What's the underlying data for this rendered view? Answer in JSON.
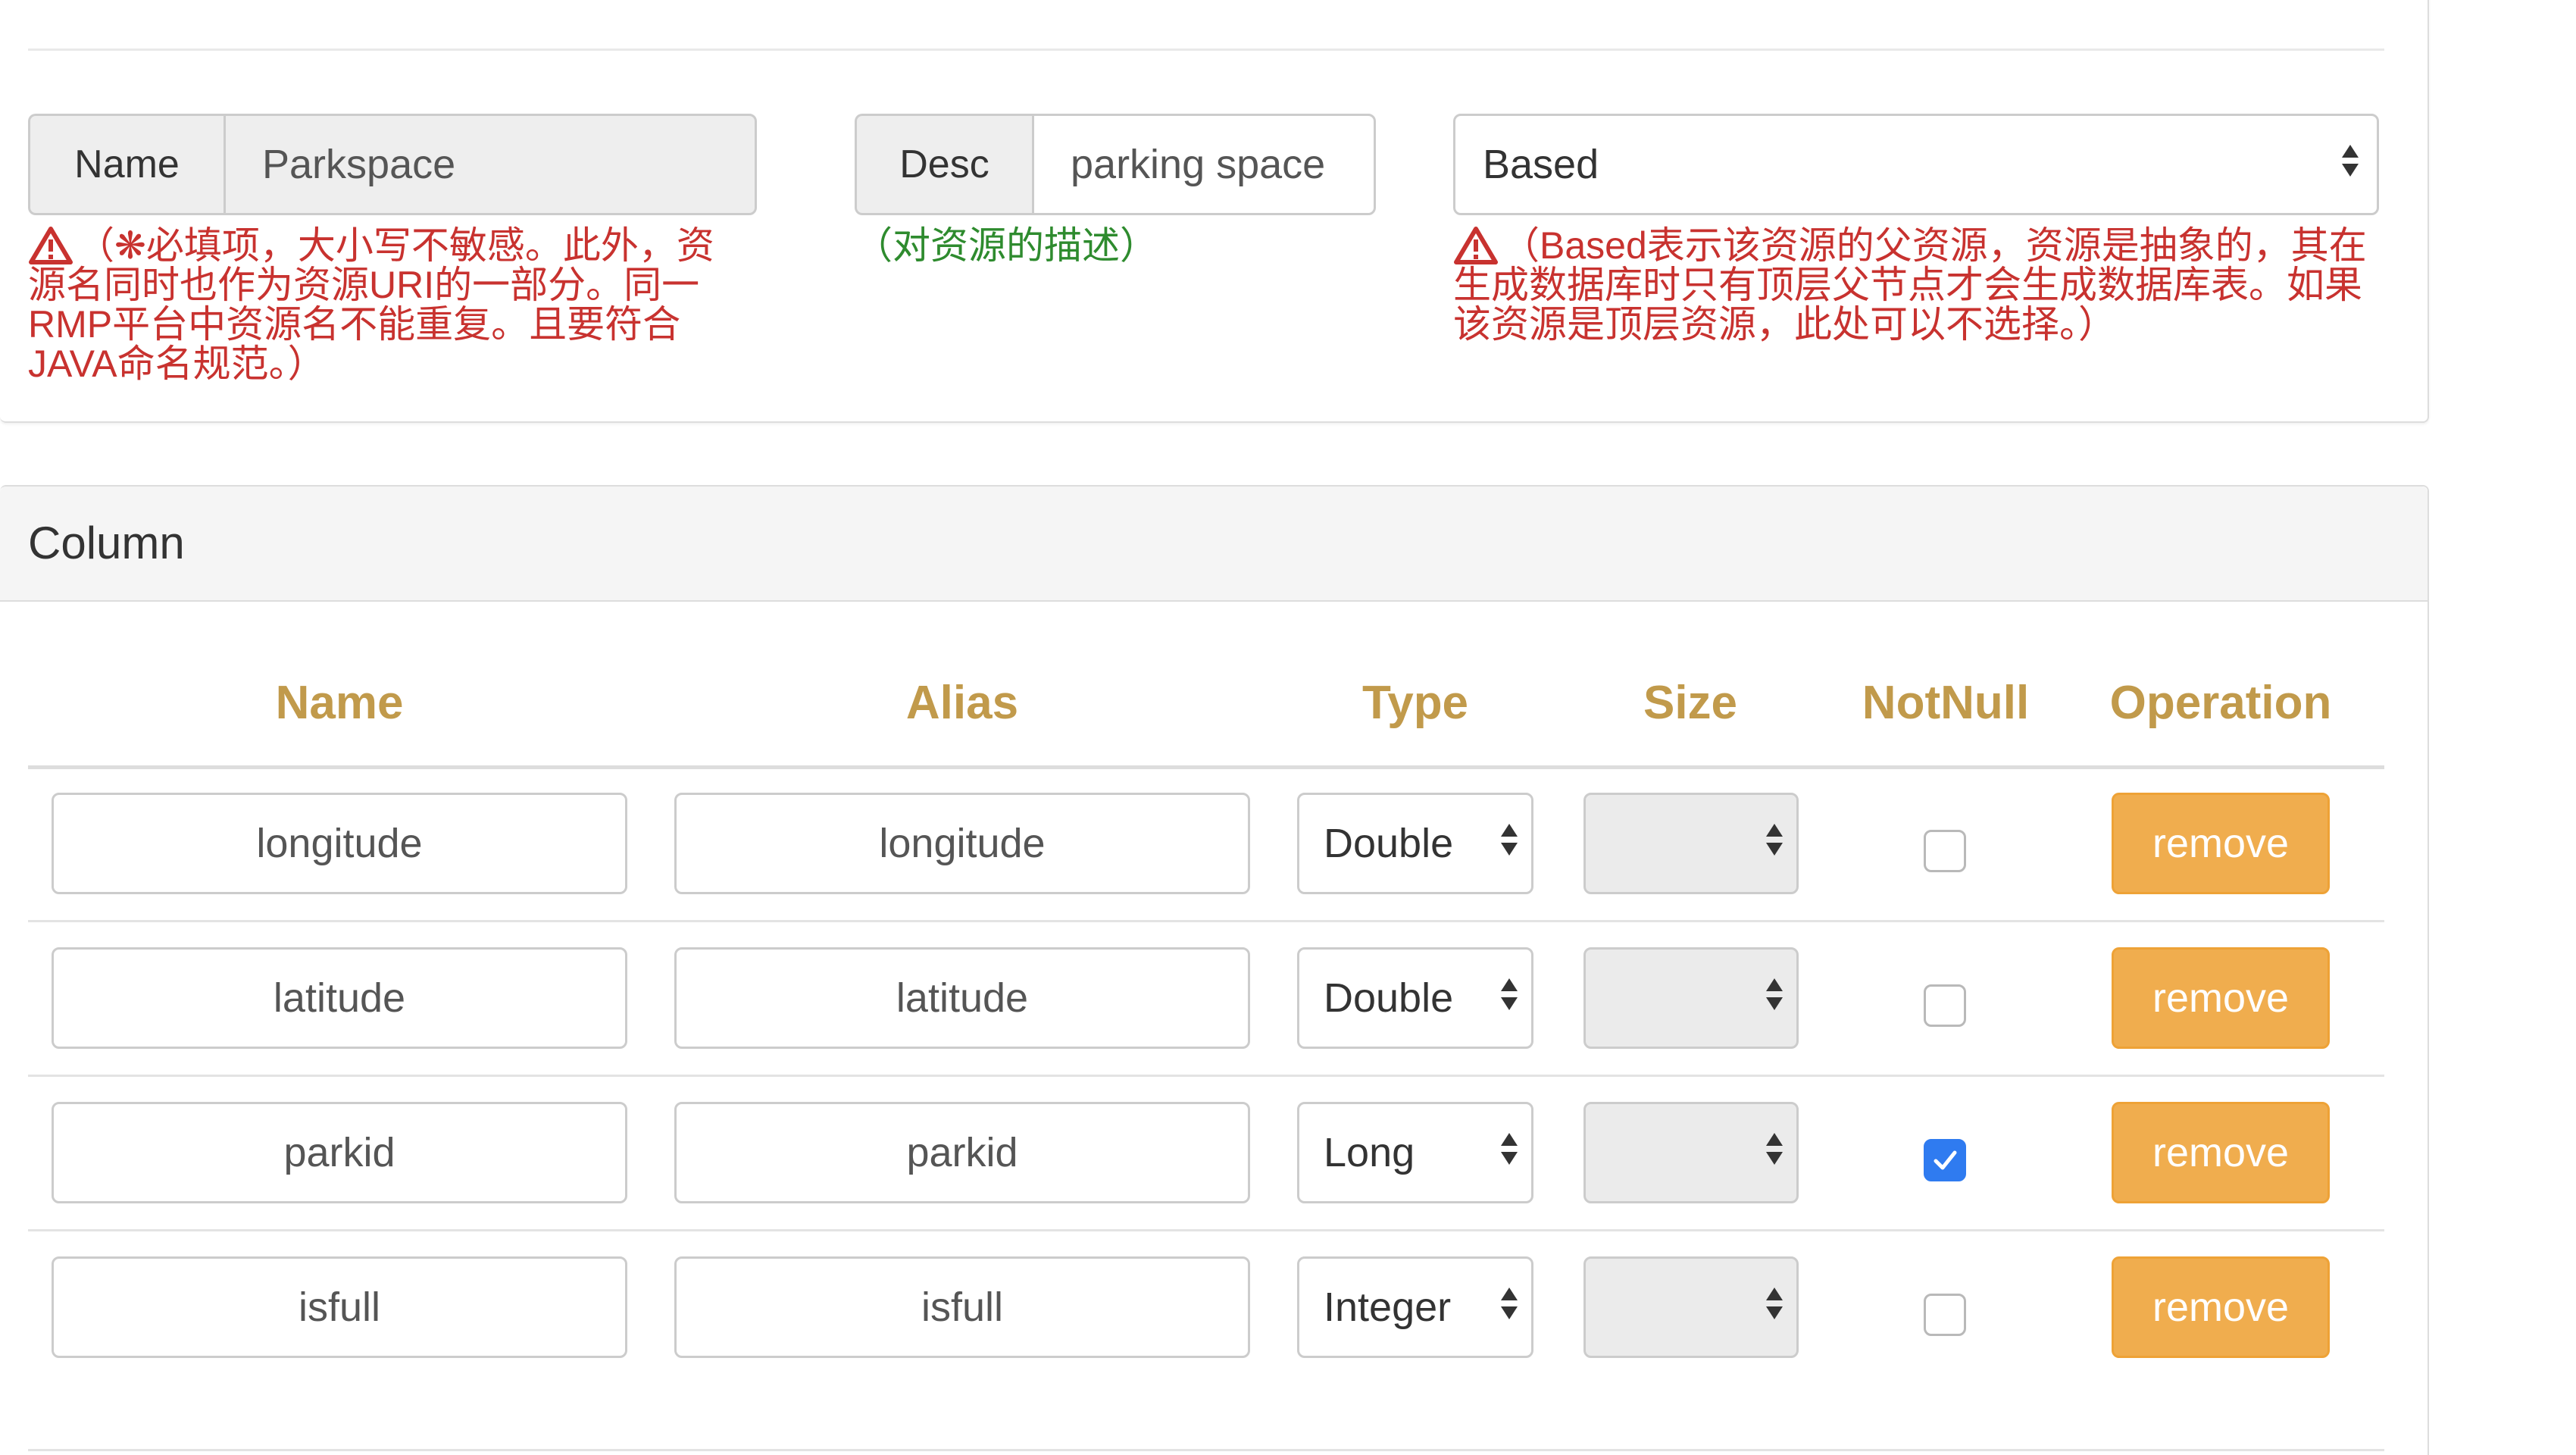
{
  "resource": {
    "name_label": "Name",
    "name_value": "Parkspace",
    "name_hint": "（❋必填项，大小写不敏感。此外，资源名同时也作为资源URI的一部分。同一RMP平台中资源名不能重复。且要符合JAVA命名规范。）",
    "desc_label": "Desc",
    "desc_value": "parking space",
    "desc_hint": "（对资源的描述）",
    "based_value": "Based",
    "based_hint": "（Based表示该资源的父资源，资源是抽象的，其在生成数据库时只有顶层父节点才会生成数据库表。如果该资源是顶层资源，此处可以不选择。）"
  },
  "column_panel": {
    "title": "Column",
    "headers": {
      "name": "Name",
      "alias": "Alias",
      "type": "Type",
      "size": "Size",
      "notnull": "NotNull",
      "operation": "Operation"
    },
    "rows": [
      {
        "name": "longitude",
        "alias": "longitude",
        "type": "Double",
        "size": "",
        "notnull": false,
        "action": "remove"
      },
      {
        "name": "latitude",
        "alias": "latitude",
        "type": "Double",
        "size": "",
        "notnull": false,
        "action": "remove"
      },
      {
        "name": "parkid",
        "alias": "parkid",
        "type": "Long",
        "size": "",
        "notnull": true,
        "action": "remove"
      },
      {
        "name": "isfull",
        "alias": "isfull",
        "type": "Integer",
        "size": "",
        "notnull": false,
        "action": "remove"
      }
    ]
  },
  "colors": {
    "header_text": "#c19a4b",
    "warning_text": "#c8322f",
    "hint_green": "#2e8b2e",
    "button_warning": "#f0ad4e",
    "checkbox_checked": "#2f7bf0"
  },
  "icons": {
    "warning": "warning-triangle-icon",
    "select_arrows": "select-arrows-icon",
    "checkmark": "checkmark-icon"
  }
}
